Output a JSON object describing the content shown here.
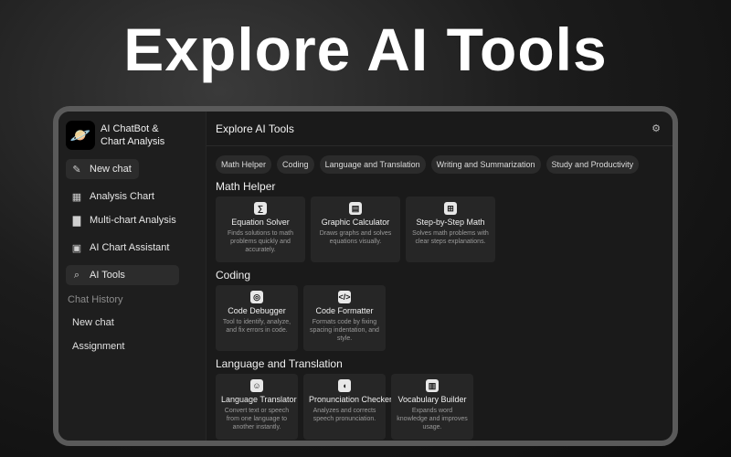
{
  "hero_title": "Explore AI Tools",
  "brand": {
    "line1": "AI ChatBot &",
    "line2": "Chart Analysis",
    "logo_icon": "planet-icon"
  },
  "sidebar": {
    "new_chat": "New chat",
    "items": [
      {
        "label": "Analysis Chart",
        "icon": "chart-icon"
      },
      {
        "label": "Multi-chart Analysis",
        "icon": "bar-chart-icon"
      },
      {
        "label": "AI Chart Assistant",
        "icon": "assistant-icon"
      },
      {
        "label": "AI Tools",
        "icon": "search-icon",
        "active": true
      }
    ],
    "history_title": "Chat History",
    "history": [
      "New chat",
      "Assignment"
    ]
  },
  "main": {
    "title": "Explore AI Tools",
    "chips": [
      "Math Helper",
      "Coding",
      "Language and Translation",
      "Writing and Summarization",
      "Study and Productivity"
    ],
    "sections": [
      {
        "title": "Math Helper",
        "cards": [
          {
            "name": "Equation Solver",
            "desc": "Finds solutions to math problems quickly and accurately.",
            "icon": "equation-icon"
          },
          {
            "name": "Graphic Calculator",
            "desc": "Draws graphs and solves equations visually.",
            "icon": "calculator-icon"
          },
          {
            "name": "Step-by-Step Math",
            "desc": "Solves math problems with clear steps explanations.",
            "icon": "grid-icon"
          }
        ]
      },
      {
        "title": "Coding",
        "cards": [
          {
            "name": "Code Debugger",
            "desc": "Tool to identify, analyze, and fix errors in code.",
            "icon": "bug-icon"
          },
          {
            "name": "Code Formatter",
            "desc": "Formats code by fixing spacing indentation, and style.",
            "icon": "code-icon"
          }
        ]
      },
      {
        "title": "Language and Translation",
        "cards": [
          {
            "name": "Language Translator",
            "desc": "Convert text or speech from one language to another instantly.",
            "icon": "translate-icon"
          },
          {
            "name": "Pronunciation Checker",
            "desc": "Analyzes and corrects speech pronunciation.",
            "icon": "speech-icon"
          },
          {
            "name": "Vocabulary Builder",
            "desc": "Expands word knowledge and improves usage.",
            "icon": "book-icon"
          }
        ]
      }
    ]
  }
}
